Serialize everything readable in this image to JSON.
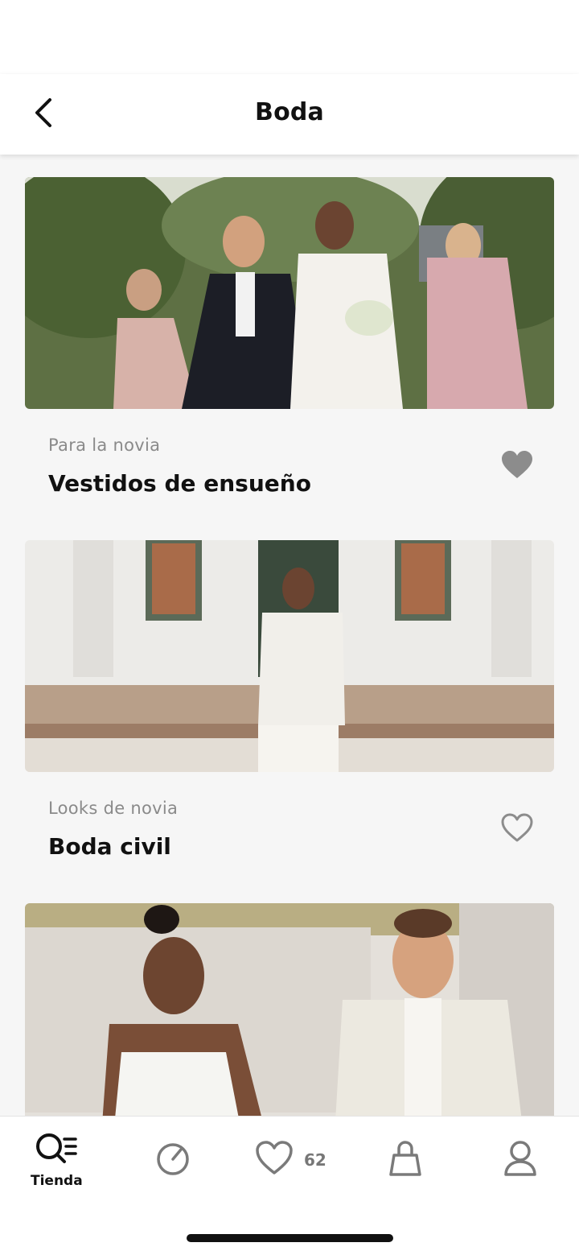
{
  "header": {
    "title": "Boda"
  },
  "cards": [
    {
      "subtitle": "Para la novia",
      "title": "Vestidos de ensueño",
      "favorited": true
    },
    {
      "subtitle": "Looks de novia",
      "title": "Boda civil",
      "favorited": false
    },
    {
      "subtitle": "",
      "title": "",
      "favorited": false
    }
  ],
  "bottom_nav": {
    "items": [
      {
        "icon": "shop-search-icon",
        "label": "Tienda",
        "active": true
      },
      {
        "icon": "discover-icon"
      },
      {
        "icon": "heart-icon",
        "count": "62"
      },
      {
        "icon": "bag-icon"
      },
      {
        "icon": "profile-icon"
      }
    ]
  },
  "colors": {
    "background": "#f6f6f6",
    "heart_filled": "#8c8c8c",
    "subtitle": "#8a8a8a"
  }
}
